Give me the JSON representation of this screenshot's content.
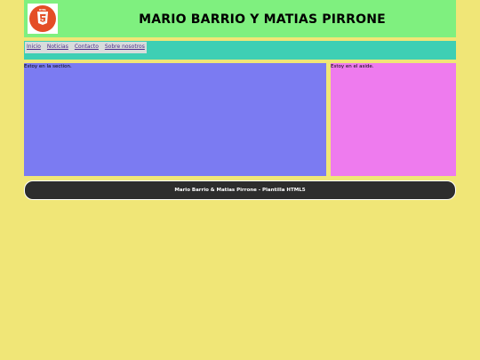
{
  "header": {
    "logo_icon": "html5-icon",
    "title": "MARIO BARRIO Y MATIAS PIRRONE"
  },
  "nav": {
    "items": [
      {
        "label": "Inicio"
      },
      {
        "label": "Noticias"
      },
      {
        "label": "Contacto"
      },
      {
        "label": "Sobre nosotros"
      }
    ]
  },
  "section": {
    "text": "Estoy en la section."
  },
  "aside": {
    "text": "Estoy en el aside."
  },
  "footer": {
    "text": "Mario Barrio & Matias Pirrone - Plantilla HTML5"
  },
  "colors": {
    "page_bg": "#f0e677",
    "header_bg": "#7ff07f",
    "nav_bg": "#3ecfb4",
    "section_bg": "#7b7bf2",
    "aside_bg": "#ee7bee",
    "footer_bg": "#2d2d2d",
    "html5_orange": "#e44d26"
  }
}
